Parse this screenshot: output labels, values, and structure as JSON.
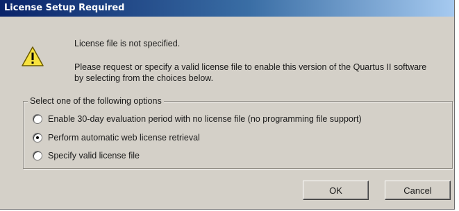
{
  "dialog": {
    "title": "License Setup Required",
    "message_line1": "License file is not specified.",
    "message_line2": "Please request or specify a valid license file to enable this version of the Quartus II software by selecting from the choices below."
  },
  "options": {
    "group_label": "Select one of the following options",
    "items": [
      {
        "label": "Enable 30-day evaluation period with no license file (no programming file support)",
        "selected": false
      },
      {
        "label": "Perform automatic web license retrieval",
        "selected": true
      },
      {
        "label": "Specify valid license file",
        "selected": false
      }
    ]
  },
  "buttons": {
    "ok_label": "OK",
    "cancel_label": "Cancel"
  },
  "colors": {
    "title_bar_start": "#0a246a",
    "dialog_face": "#d4d0c8"
  },
  "icons": {
    "warning": "warning-icon"
  }
}
